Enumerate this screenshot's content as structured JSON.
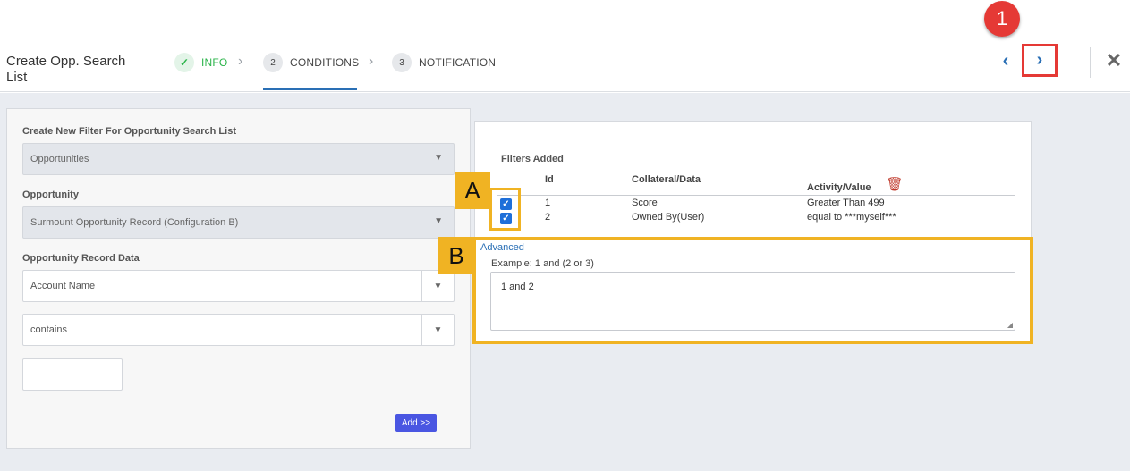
{
  "header": {
    "title": "Create Opp. Search List",
    "steps": [
      {
        "num": "✓",
        "label": "INFO",
        "state": "done"
      },
      {
        "num": "2",
        "label": "CONDITIONS",
        "state": "active"
      },
      {
        "num": "3",
        "label": "NOTIFICATION",
        "state": "pending"
      }
    ],
    "prev_icon": "‹",
    "next_icon": "›",
    "close_icon": "✕",
    "annotation_badge": "1"
  },
  "left_panel": {
    "filter_label": "Create New Filter For Opportunity Search List",
    "filter_value": "Opportunities",
    "opportunity_label": "Opportunity",
    "opportunity_value": "Surmount Opportunity Record (Configuration B)",
    "record_data_label": "Opportunity Record Data",
    "field_value": "Account Name",
    "operator_value": "contains",
    "add_button": "Add >>"
  },
  "right_panel": {
    "title": "Filters Added",
    "columns": {
      "id": "Id",
      "collateral": "Collateral/Data",
      "activity": "Activity/Value"
    },
    "rows": [
      {
        "id": "1",
        "collateral": "Score",
        "activity": "Greater Than 499",
        "checked": true
      },
      {
        "id": "2",
        "collateral": "Owned By(User)",
        "activity": "equal to ***myself***",
        "checked": true
      }
    ],
    "advanced_link": "Advanced",
    "example": "Example: 1 and (2 or 3)",
    "expression": "1 and 2"
  },
  "annotations": {
    "a": "A",
    "b": "B"
  },
  "colors": {
    "accent": "#2a6fb5",
    "success": "#2bb44a",
    "highlight": "#f0b323",
    "alert": "#e53935",
    "button": "#4a56e2"
  }
}
